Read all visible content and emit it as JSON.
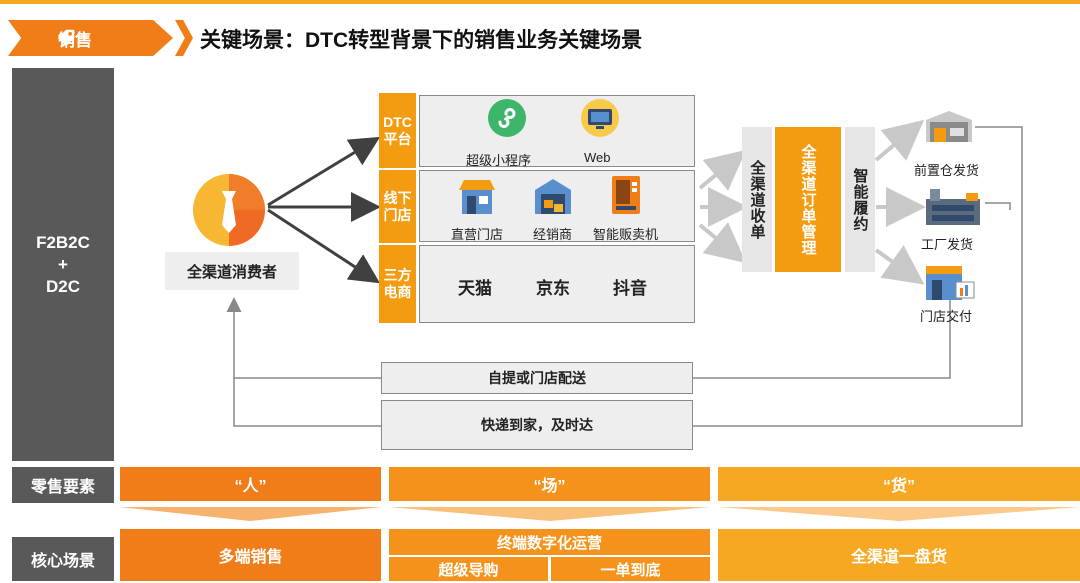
{
  "header": {
    "tag_label": "销售",
    "title": "关键场景：DTC转型背景下的销售业务关键场景"
  },
  "left_column": {
    "line1": "F2B2C",
    "line2": "+",
    "line3": "D2C"
  },
  "consumer": {
    "label": "全渠道消费者"
  },
  "channels": [
    {
      "label": "DTC平台",
      "items": [
        "超级小程序",
        "Web"
      ]
    },
    {
      "label": "线下门店",
      "items": [
        "直营门店",
        "经销商",
        "智能贩卖机"
      ]
    },
    {
      "label": "三方电商",
      "items": [
        "天猫",
        "京东",
        "抖音"
      ]
    }
  ],
  "flow": {
    "collect": "全渠道收单",
    "order_mgmt": "全渠道订单管理",
    "fulfill": "智能履约"
  },
  "warehouses": [
    "前置仓发货",
    "工厂发货",
    "门店交付"
  ],
  "delivery": [
    "自提或门店配送",
    "快递到家，及时达"
  ],
  "retail_elements": {
    "label": "零售要素",
    "items": [
      "“人”",
      "“场”",
      "“货”"
    ]
  },
  "core_scenarios": {
    "label": "核心场景",
    "left": "多端销售",
    "middle": "终端数字化运营",
    "middle_sub": [
      "超级导购",
      "一单到底"
    ],
    "right": "全渠道一盘货"
  },
  "colors": {
    "orange": "#f39c12",
    "dark_orange": "#f07d17",
    "grey": "#595959",
    "light_grey": "#eeeeee"
  }
}
